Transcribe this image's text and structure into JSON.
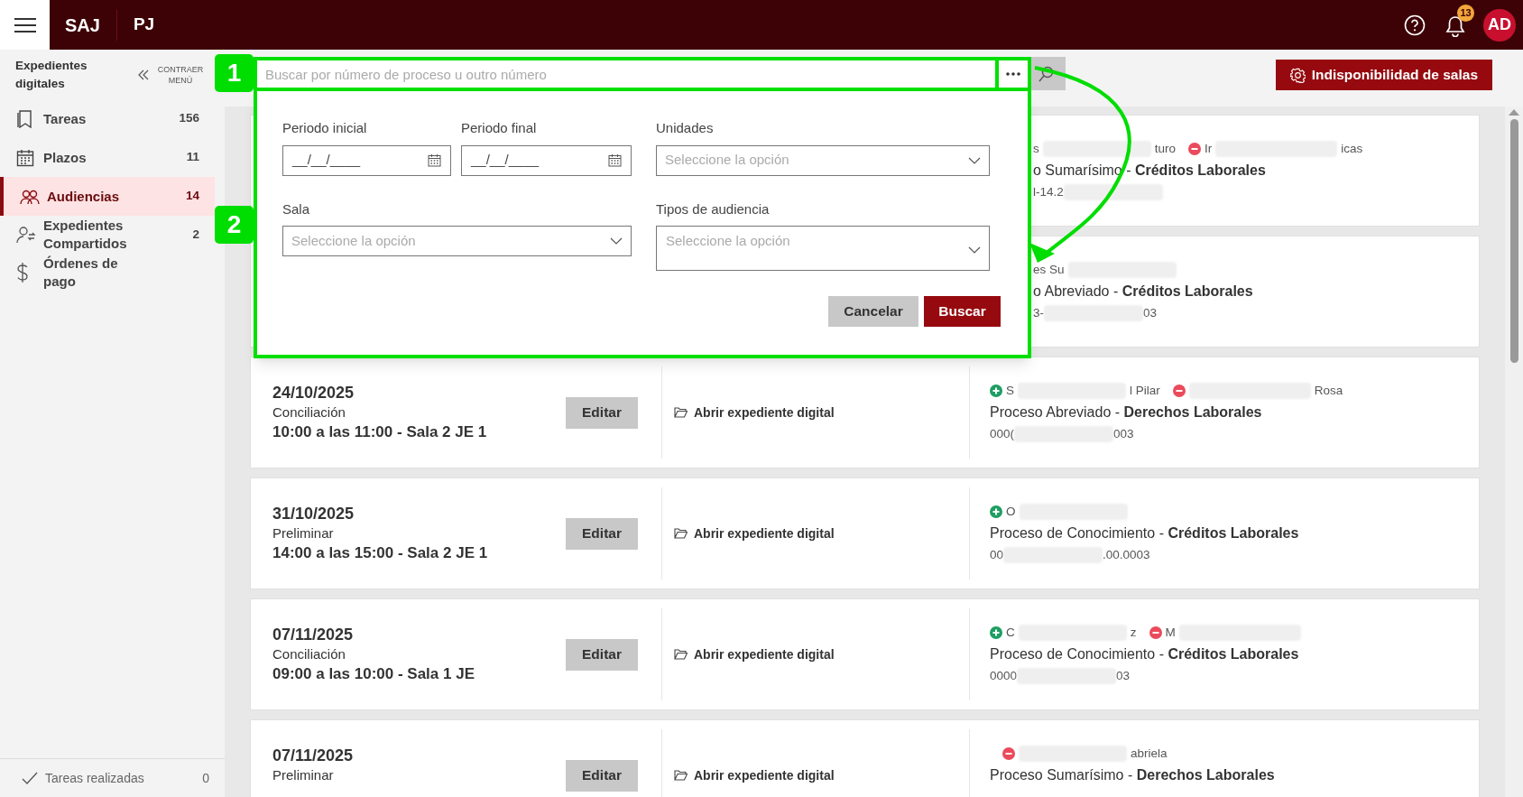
{
  "top_bar": {
    "brand": "SAJ",
    "org": "PJ",
    "notifications_count": "13",
    "avatar_initials": "AD"
  },
  "sidebar": {
    "title": "Expedientes digitales",
    "collapse_label": "CONTRAER MENÚ",
    "items": [
      {
        "kind": "bookmark",
        "label": "Tareas",
        "count": "156",
        "selected": false
      },
      {
        "kind": "calendar",
        "label": "Plazos",
        "count": "11",
        "selected": false
      },
      {
        "kind": "people",
        "label": "Audiencias",
        "count": "14",
        "selected": true
      },
      {
        "kind": "shared",
        "label": "Expedientes Compartidos",
        "count": "2",
        "selected": false
      },
      {
        "kind": "dollar",
        "label": "Órdenes de pago",
        "selected": false
      }
    ],
    "footer": {
      "label": "Tareas realizadas",
      "count": "0"
    }
  },
  "search": {
    "placeholder": "Buscar por número de proceso u outro número"
  },
  "unavailability_button": "Indisponibilidad de salas",
  "filter_panel": {
    "fields": [
      {
        "kind": "date",
        "label": "Periodo inicial",
        "placeholder": "__/__/____"
      },
      {
        "kind": "date",
        "label": "Periodo final",
        "placeholder": "__/__/____"
      },
      {
        "kind": "select",
        "label": "Unidades",
        "placeholder": "Seleccione la opción"
      },
      {
        "kind": "select",
        "label": "Sala",
        "placeholder": "Seleccione la opción"
      },
      {
        "kind": "multiselect",
        "label": "Tipos de audiencia",
        "placeholder": "Seleccione la opción"
      }
    ],
    "cancel_button": "Cancelar",
    "search_button": "Buscar"
  },
  "annotations": [
    {
      "label": "1"
    },
    {
      "label": "2"
    }
  ],
  "hearings": [
    {
      "kind": "covered",
      "parties": [
        {
          "kind": "plain",
          "prefix": "s",
          "suffix": "turo"
        },
        {
          "kind": "removed",
          "prefix": "Ir",
          "suffix": "icas"
        }
      ],
      "process": "o Sumarísimo - **Créditos Laborales**",
      "number": {
        "prefix": "l-14.2"
      }
    },
    {
      "kind": "covered",
      "parties": [
        {
          "kind": "plain",
          "prefix": "es Su"
        }
      ],
      "process": "o Abreviado - **Créditos Laborales**",
      "number": {
        "prefix": "3-",
        "suffix": "03"
      }
    },
    {
      "kind": "full",
      "date": "24/10/2025",
      "type": "Conciliación",
      "time": "10:00 a las 11:00 - Sala 2 JE 1",
      "edit": "Editar",
      "open_link": "Abrir expediente digital",
      "parties": [
        {
          "kind": "added",
          "prefix": "S",
          "suffix": "l Pilar"
        },
        {
          "kind": "removed",
          "suffix": "Rosa"
        }
      ],
      "process": "Proceso Abreviado - **Derechos Laborales**",
      "number": {
        "prefix": "000(",
        "suffix": "003"
      }
    },
    {
      "kind": "full",
      "date": "31/10/2025",
      "type": "Preliminar",
      "time": "14:00 a las 15:00 - Sala 2 JE 1",
      "edit": "Editar",
      "open_link": "Abrir expediente digital",
      "parties": [
        {
          "kind": "added",
          "prefix": "O"
        }
      ],
      "process": "Proceso de Conocimiento - **Créditos Laborales**",
      "number": {
        "prefix": "00",
        "suffix": ".00.0003"
      }
    },
    {
      "kind": "full",
      "date": "07/11/2025",
      "type": "Conciliación",
      "time": "09:00 a las 10:00 - Sala 1 JE",
      "edit": "Editar",
      "open_link": "Abrir expediente digital",
      "parties": [
        {
          "kind": "added",
          "prefix": "C",
          "suffix": "z"
        },
        {
          "kind": "removed",
          "prefix": "M"
        }
      ],
      "process": "Proceso de Conocimiento - **Créditos Laborales**",
      "number": {
        "prefix": "0000",
        "suffix": "03"
      }
    },
    {
      "kind": "full",
      "date": "07/11/2025",
      "type": "Preliminar",
      "edit": "Editar",
      "open_link": "Abrir expediente digital",
      "parties": [
        {
          "kind": "removed",
          "suffix": "abriela"
        }
      ],
      "process": "Proceso Sumarísimo - **Derechos Laborales**"
    }
  ]
}
